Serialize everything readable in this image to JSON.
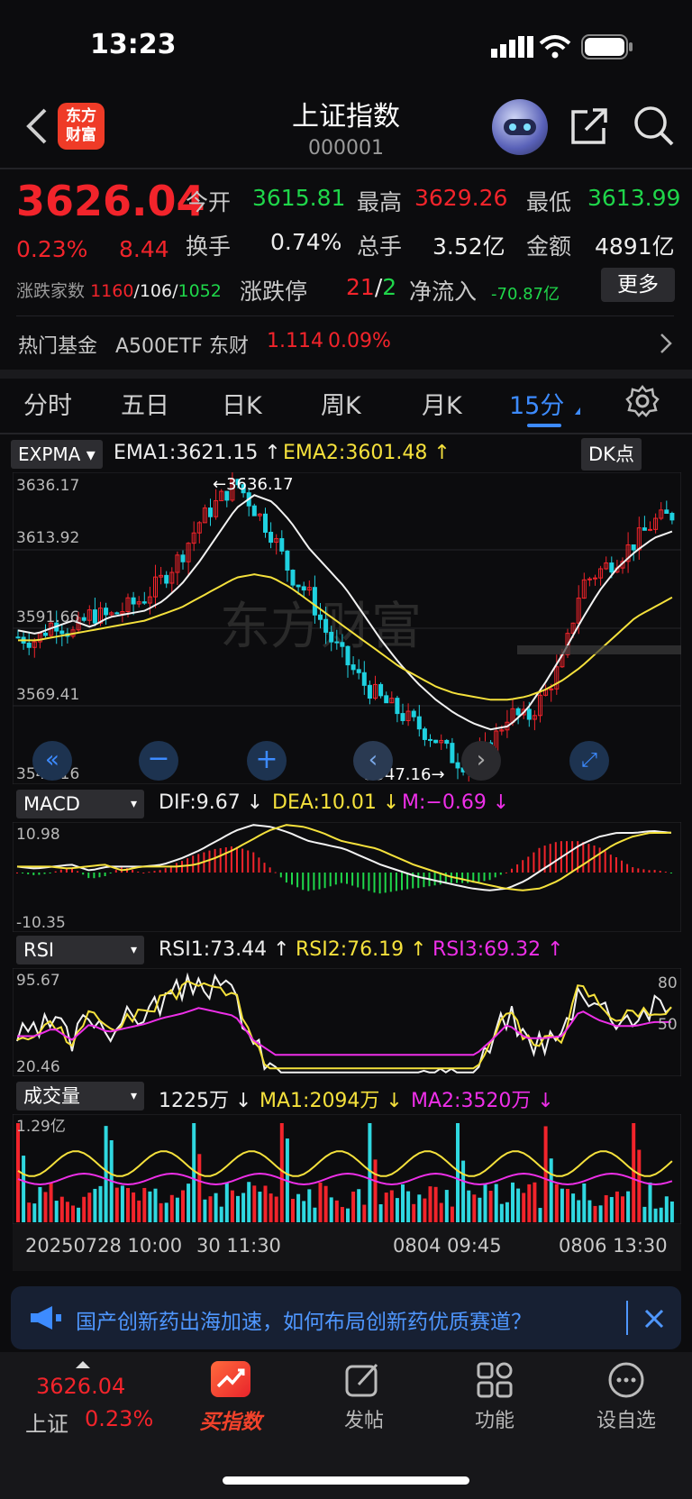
{
  "status": {
    "time": "13:23"
  },
  "header": {
    "title": "上证指数",
    "code": "000001",
    "logo": "东方\n财富"
  },
  "quote": {
    "price": "3626.04",
    "change_pct": "0.23%",
    "change": "8.44",
    "open_label": "今开",
    "open": "3615.81",
    "high_label": "最高",
    "high": "3629.26",
    "low_label": "最低",
    "low": "3613.99",
    "turnover_label": "换手",
    "turnover": "0.74%",
    "volume_label": "总手",
    "volume": "3.52亿",
    "amount_label": "金额",
    "amount": "4891亿",
    "breadth_label": "涨跌家数",
    "up": "1160",
    "flat": "106",
    "down": "1052",
    "limit_label": "涨跌停",
    "limit_up": "21",
    "limit_down": "2",
    "inflow_label": "净流入",
    "inflow": "-70.87亿",
    "more": "更多"
  },
  "fund": {
    "label": "热门基金",
    "name": "A500ETF 东财",
    "price": "1.114",
    "pct": "0.09%"
  },
  "tabs": [
    {
      "label": "分时"
    },
    {
      "label": "五日"
    },
    {
      "label": "日K"
    },
    {
      "label": "周K"
    },
    {
      "label": "月K"
    },
    {
      "label": "15分"
    }
  ],
  "main_chart": {
    "indicator": "EXPMA",
    "ema1": "EMA1:3621.15",
    "ema2": "EMA2:3601.48",
    "dk": "DK点",
    "y_labels": [
      "3636.17",
      "3613.92",
      "3591.66",
      "3569.41",
      "3547.16"
    ],
    "max_label": "3636.17",
    "min_label": "3547.16",
    "watermark": "东方财富"
  },
  "macd": {
    "name": "MACD",
    "dif": "DIF:9.67",
    "dea": "DEA:10.01",
    "m": "M:−0.69",
    "top": "10.98",
    "bottom": "-10.35"
  },
  "rsi": {
    "name": "RSI",
    "rsi1": "RSI1:73.44",
    "rsi2": "RSI2:76.19",
    "rsi3": "RSI3:69.32",
    "top": "95.67",
    "bottom": "20.46",
    "lvl80": "80",
    "lvl50": "50"
  },
  "vol": {
    "name": "成交量",
    "cur": "1225万",
    "ma1": "MA1:2094万",
    "ma2": "MA2:3520万",
    "top": "1.29亿"
  },
  "x_axis": [
    "20250728 10:00",
    "30 11:30",
    "0804 09:45",
    "0806 13:30"
  ],
  "banner": {
    "text": "国产创新药出海加速，如何布局创新药优质赛道？"
  },
  "nav": {
    "index_price": "3626.04",
    "index_name": "上证",
    "index_pct": "0.23%",
    "items": [
      {
        "label": "买指数"
      },
      {
        "label": "发帖"
      },
      {
        "label": "功能"
      },
      {
        "label": "设自选"
      }
    ]
  },
  "chart_data": {
    "type": "candlestick",
    "y_range": [
      3547.16,
      3636.17
    ],
    "ema1_last": 3621.15,
    "ema2_last": 3601.48,
    "x_labels": [
      "20250728 10:00",
      "30 11:30",
      "0804 09:45",
      "0806 13:30"
    ],
    "ema1": [
      3591,
      3590,
      3592,
      3594,
      3592,
      3595,
      3596,
      3597,
      3600,
      3605,
      3612,
      3620,
      3628,
      3632,
      3630,
      3624,
      3616,
      3610,
      3604,
      3596,
      3588,
      3581,
      3575,
      3570,
      3566,
      3563,
      3561,
      3562,
      3567,
      3575,
      3584,
      3594,
      3603,
      3610,
      3615,
      3619,
      3621
    ],
    "ema2": [
      3588,
      3588,
      3589,
      3590,
      3591,
      3592,
      3593,
      3594,
      3596,
      3598,
      3601,
      3604,
      3607,
      3608,
      3607,
      3604,
      3600,
      3596,
      3592,
      3588,
      3584,
      3580,
      3577,
      3574,
      3572,
      3571,
      3570,
      3570,
      3571,
      3573,
      3576,
      3580,
      3585,
      3590,
      3595,
      3598,
      3601
    ],
    "close": [
      3589,
      3588,
      3594,
      3590,
      3596,
      3595,
      3598,
      3601,
      3607,
      3614,
      3624,
      3630,
      3636,
      3628,
      3620,
      3608,
      3602,
      3590,
      3582,
      3575,
      3570,
      3566,
      3562,
      3558,
      3552,
      3550,
      3556,
      3566,
      3564,
      3572,
      3582,
      3605,
      3609,
      3613,
      3618,
      3624,
      3626
    ]
  }
}
